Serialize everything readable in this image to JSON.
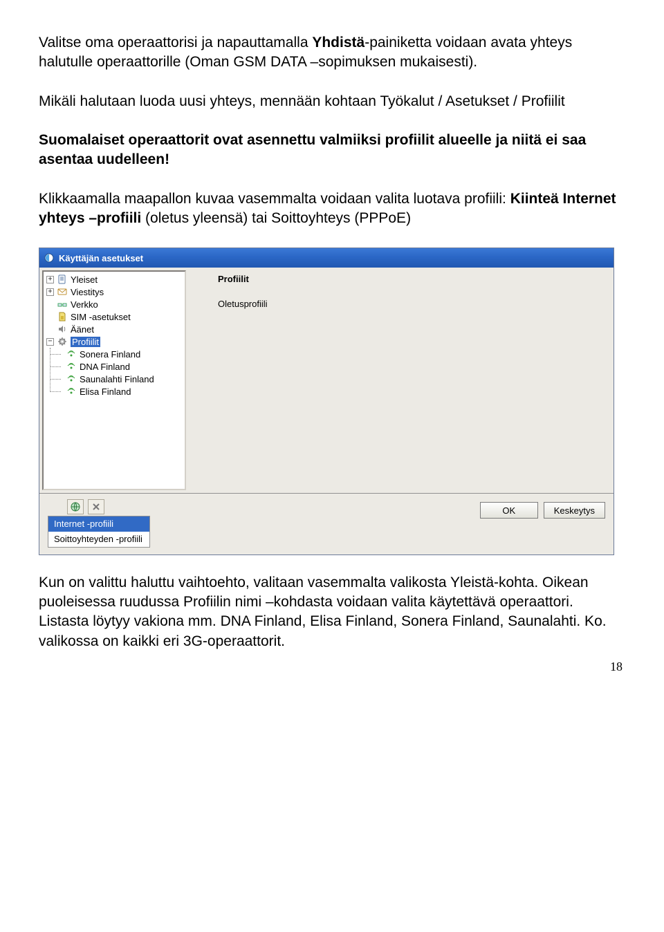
{
  "para1": {
    "t1": "Valitse oma operaattorisi ja napauttamalla ",
    "b1": "Yhdistä",
    "t2": "-painiketta voidaan avata yhteys halutulle operaattorille (Oman GSM DATA –sopimuksen mukaisesti)."
  },
  "para2": "Mikäli halutaan luoda uusi yhteys, mennään kohtaan Työkalut / Asetukset / Profiilit",
  "para3": "Suomalaiset operaattorit ovat asennettu valmiiksi profiilit alueelle ja niitä ei saa asentaa uudelleen!",
  "para4": {
    "t1": "Klikkaamalla maapallon kuvaa vasemmalta voidaan valita luotava profiili: ",
    "b1": "Kiinteä Internet yhteys –profiili",
    "t2": " (oletus yleensä) tai Soittoyhteys (PPPoE)"
  },
  "window": {
    "title": "Käyttäjän asetukset",
    "tree": {
      "items": [
        {
          "label": "Yleiset"
        },
        {
          "label": "Viestitys"
        },
        {
          "label": "Verkko"
        },
        {
          "label": "SIM -asetukset"
        },
        {
          "label": "Äänet"
        },
        {
          "label": "Profiilit"
        }
      ],
      "sub": [
        {
          "label": "Sonera Finland"
        },
        {
          "label": "DNA Finland"
        },
        {
          "label": "Saunalahti Finland"
        },
        {
          "label": "Elisa Finland"
        }
      ]
    },
    "right": {
      "heading": "Profiilit",
      "sub": "Oletusprofiili"
    },
    "popup": [
      "Internet -profiili",
      "Soittoyhteyden -profiili"
    ],
    "buttons": {
      "ok": "OK",
      "cancel": "Keskeytys"
    }
  },
  "para5": "Kun on valittu haluttu vaihtoehto, valitaan vasemmalta valikosta Yleistä-kohta. Oikean puoleisessa ruudussa Profiilin nimi –kohdasta voidaan valita käytettävä operaattori. Listasta löytyy vakiona mm. DNA Finland, Elisa Finland, Sonera Finland, Saunalahti. Ko. valikossa on kaikki eri 3G-operaattorit.",
  "page_number": "18"
}
